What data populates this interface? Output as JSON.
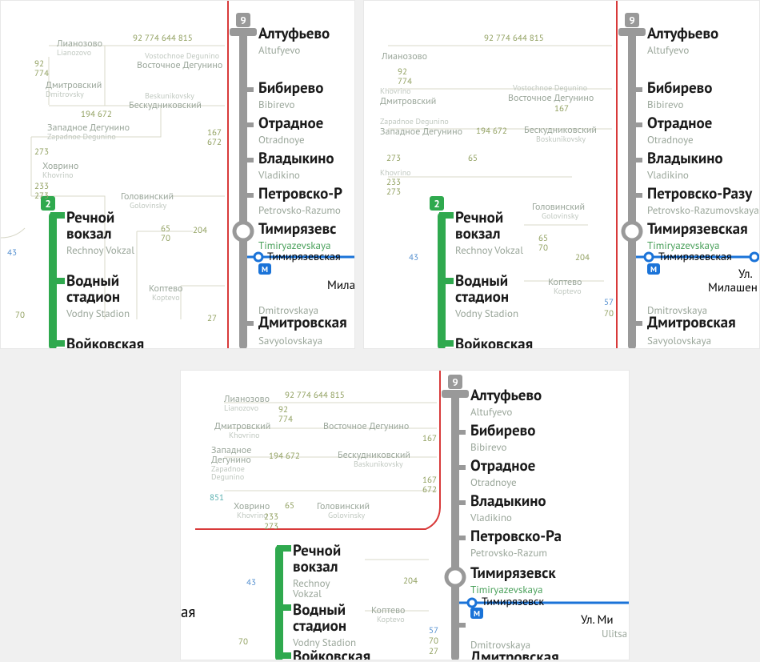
{
  "line9_badge": "9",
  "line2_badge": "2",
  "m_badge": "M",
  "grey_stations": [
    {
      "ru": "Алтуфьево",
      "en": "Altufyevo"
    },
    {
      "ru": "Бибирево",
      "en": "Bibirevo"
    },
    {
      "ru": "Отрадное",
      "en": "Otradnoye"
    },
    {
      "ru": "Владыкино",
      "en": "Vladikino"
    },
    {
      "ru": "Петровско-Разумовская",
      "en": "Petrovsko-Razumovskaya"
    },
    {
      "ru": "Тимирязевская",
      "en": "Timiryazevskaya"
    },
    {
      "ru": "Дмитровская",
      "en": "Dmitrovskaya"
    }
  ],
  "monorail_branch_1": {
    "ru": "Тимирязевская",
    "en": ""
  },
  "monorail_branch_2": {
    "ru": "Тимирязевская",
    "en": ""
  },
  "monorail_branch_3": {
    "ru": "Тимирязевская",
    "en": ""
  },
  "mila_partial": "Мила",
  "ul_milashen_ru": "Ул.",
  "ul_milashen_ru2": "Милашен",
  "ul_mi_ru": "Ул. Ми",
  "ulitsa_en": "Ulitsa",
  "savyol_en": "Savyolovskaya",
  "green_stations": [
    {
      "ru": "Речной\nвокзал",
      "en": "Rechnoy Vokzal"
    },
    {
      "ru": "Водный\nстадион",
      "en": "Vodny Stadion"
    },
    {
      "ru": "Войковская",
      "en": ""
    }
  ],
  "bus": {
    "lianozovo": {
      "ru": "Лианозово",
      "en": "Lianozovo"
    },
    "vdegunino": {
      "ru": "Восточное Дегунино",
      "en": "Vostochnoe Degunino"
    },
    "dmitrovsky": {
      "ru": "Дмитровский",
      "en": "Dmitrovsky"
    },
    "beskudnikovsky": {
      "ru": "Бескудниковский",
      "en": "Beskunikovsky"
    },
    "zdegunino": {
      "ru": "Западное Дегунино",
      "en": "Zapadnoe Degunino"
    },
    "khovrino": {
      "ru": "Ховрино",
      "en": "Khovrino"
    },
    "golovinsky": {
      "ru": "Головинский",
      "en": "Golovinsky"
    },
    "koptevo": {
      "ru": "Коптево",
      "en": "Koptevo"
    }
  },
  "routes": {
    "top": "92 774 644 815",
    "n92": "92",
    "n774": "774",
    "n194_672": "194 672",
    "n273": "273",
    "n167": "167",
    "n672": "672",
    "n233": "233",
    "n65": "65",
    "n70": "70",
    "n204": "204",
    "n43": "43",
    "n57": "57",
    "n27": "27",
    "n851": "851",
    "n194_672_sp": "194  672"
  },
  "ya_partial": "ая"
}
